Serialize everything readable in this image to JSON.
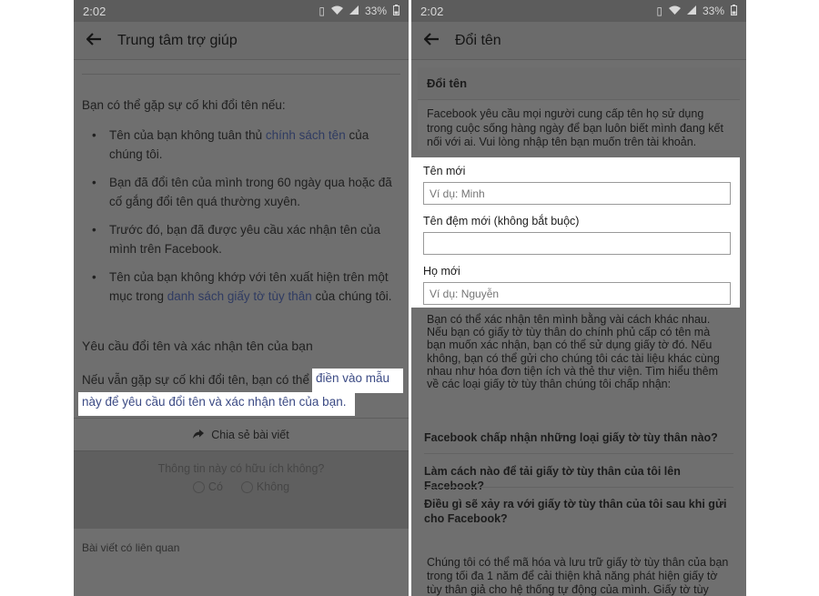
{
  "left": {
    "status": {
      "time": "2:02",
      "battery": "33%"
    },
    "appbar": {
      "title": "Trung tâm trợ giúp"
    },
    "heading": "Bạn có thể gặp sự cố khi đổi tên nếu:",
    "bullets": [
      {
        "pre": "Tên của bạn không tuân thủ ",
        "link": "chính sách tên",
        "post": " của chúng tôi."
      },
      {
        "pre": "Bạn đã đổi tên của mình trong 60 ngày qua hoặc đã cố gắng đổi tên quá thường xuyên.",
        "link": "",
        "post": ""
      },
      {
        "pre": "Trước đó, bạn đã được yêu cầu xác nhận tên của mình trên Facebook.",
        "link": "",
        "post": ""
      },
      {
        "pre": "Tên của bạn không khớp với tên xuất hiện trên một mục trong ",
        "link": "danh sách giấy tờ tùy thân",
        "post": " của chúng tôi."
      }
    ],
    "section_title": "Yêu cầu đổi tên và xác nhận tên của bạn",
    "para_pre": "Nếu vẫn gặp sự cố khi đổi tên, bạn có thể",
    "para_link1": "điền vào mẫu",
    "para_link2": "này để yêu cầu đổi tên và xác nhận tên của bạn.",
    "share_label": "Chia sẻ bài viết",
    "feedback_question": "Thông tin này có hữu ích không?",
    "yes_label": "Có",
    "no_label": "Không",
    "related_label": "Bài viết có liên quan"
  },
  "right": {
    "status": {
      "time": "2:02",
      "battery": "33%"
    },
    "appbar": {
      "title": "Đổi tên"
    },
    "section_title": "Đổi tên",
    "intro": "Facebook yêu cầu mọi người cung cấp tên họ sử dụng trong cuộc sống hàng ngày để bạn luôn biết mình đang kết nối với ai. Vui lòng nhập tên bạn muốn trên tài khoản.",
    "form": {
      "first_label": "Tên mới",
      "first_placeholder": "Ví dụ: Minh",
      "middle_label": "Tên đệm mới (không bắt buộc)",
      "middle_placeholder": "",
      "last_label": "Họ mới",
      "last_placeholder": "Ví dụ: Nguyễn"
    },
    "after_text": "Bạn có thể xác nhận tên mình bằng vài cách khác nhau. Nếu bạn có giấy tờ tùy thân do chính phủ cấp có tên mà bạn muốn xác nhận, bạn có thể sử dụng giấy tờ đó. Nếu không, bạn có thể gửi cho chúng tôi các tài liệu khác cùng nhau như hóa đơn tiện ích và thẻ thư viện. Tìm hiểu thêm về các loại giấy tờ tùy thân chúng tôi chấp nhận:",
    "faqs": [
      "Facebook chấp nhận những loại giấy tờ tùy thân nào?",
      "Làm cách nào để tải giấy tờ tùy thân của tôi lên Facebook?",
      "Điều gì sẽ xảy ra với giấy tờ tùy thân của tôi sau khi gửi cho Facebook?"
    ],
    "bottom_text": "Chúng tôi có thể mã hóa và lưu trữ giấy tờ tùy thân của bạn trong tối đa 1 năm để cải thiện khả năng phát hiện giấy tờ tùy thân giả cho hệ thống tự động của mình. Giấy tờ tùy"
  }
}
